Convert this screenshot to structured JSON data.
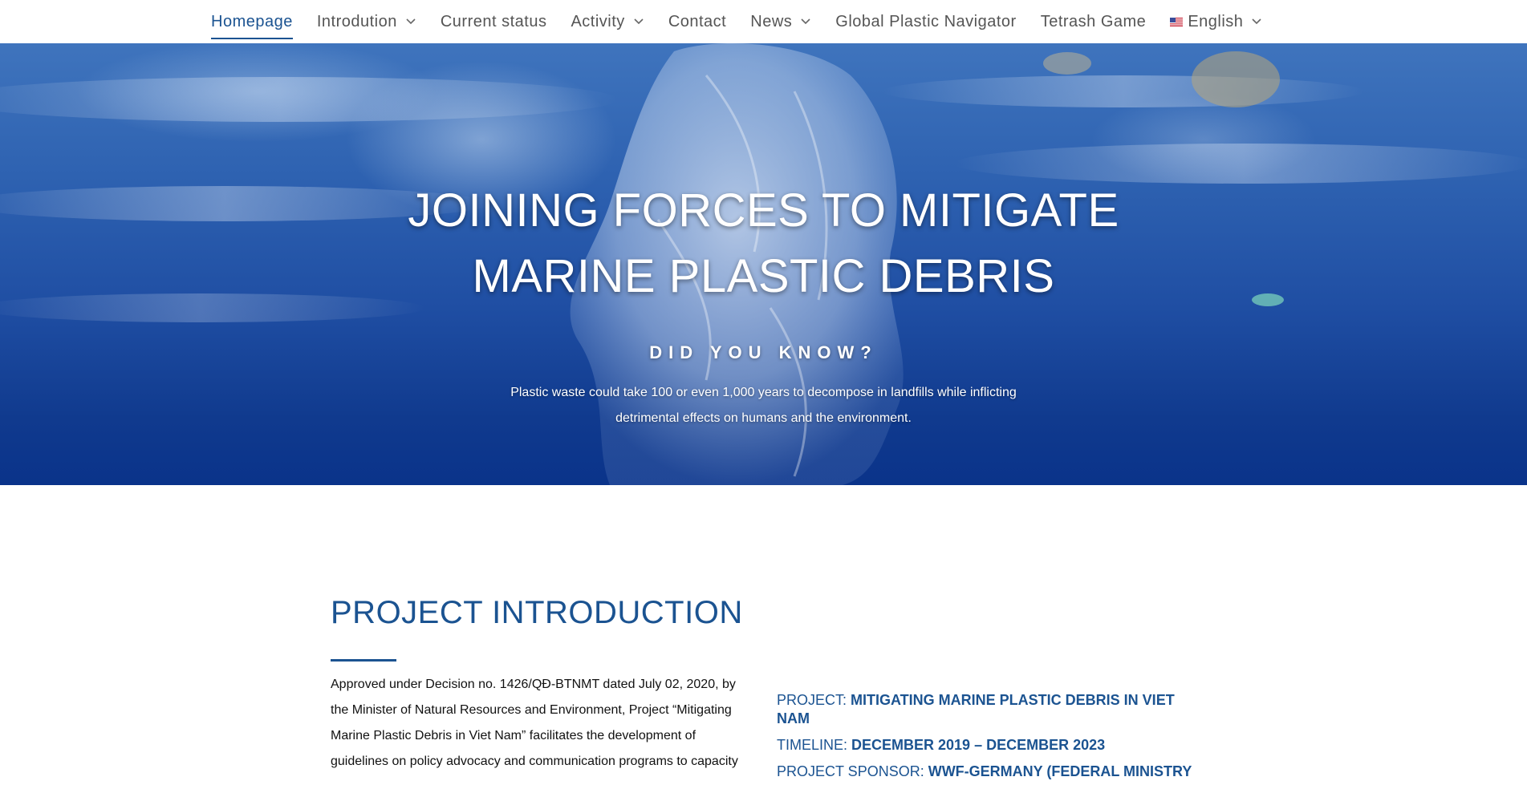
{
  "nav": {
    "items": [
      {
        "label": "Homepage",
        "active": true,
        "has_dropdown": false
      },
      {
        "label": "Introdution",
        "active": false,
        "has_dropdown": true
      },
      {
        "label": "Current status",
        "active": false,
        "has_dropdown": false
      },
      {
        "label": "Activity",
        "active": false,
        "has_dropdown": true
      },
      {
        "label": "Contact",
        "active": false,
        "has_dropdown": false
      },
      {
        "label": "News",
        "active": false,
        "has_dropdown": true
      },
      {
        "label": "Global Plastic Navigator",
        "active": false,
        "has_dropdown": false
      },
      {
        "label": "Tetrash Game",
        "active": false,
        "has_dropdown": false
      }
    ],
    "language": {
      "label": "English",
      "icon": "us-flag-icon"
    },
    "accent_color": "#1b5391"
  },
  "hero": {
    "title_line1": "JOINING FORCES TO MITIGATE",
    "title_line2": "MARINE PLASTIC DEBRIS",
    "kicker": "DID YOU KNOW?",
    "text": "Plastic waste could take 100 or even 1,000 years to decompose in landfills while inflicting detrimental effects on humans and the environment."
  },
  "intro": {
    "heading": "PROJECT INTRODUCTION",
    "text": "Approved under Decision no. 1426/QĐ-BTNMT dated July 02, 2020, by the Minister of Natural Resources and Environment, Project “Mitigating Marine Plastic Debris in Viet Nam” facilitates the development of guidelines on policy advocacy and communication programs to capacity",
    "facts": [
      {
        "label": "PROJECT: ",
        "value": "MITIGATING MARINE PLASTIC DEBRIS IN VIET NAM"
      },
      {
        "label": "TIMELINE: ",
        "value": "DECEMBER 2019 – DECEMBER 2023"
      },
      {
        "label": "PROJECT SPONSOR: ",
        "value": "WWF-GERMANY (FEDERAL MINISTRY"
      }
    ]
  }
}
